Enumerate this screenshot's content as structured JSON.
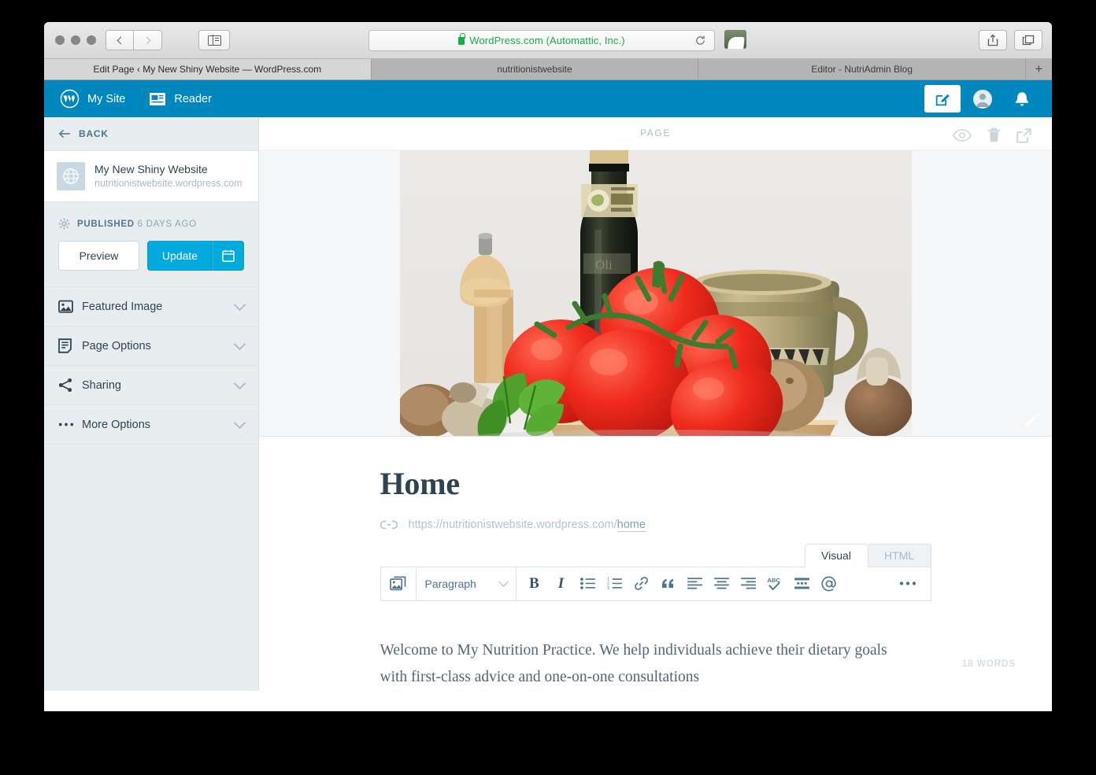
{
  "browser": {
    "url_text": "WordPress.com (Automattic, Inc.)",
    "tabs": [
      {
        "title": "Edit Page ‹ My New Shiny Website — WordPress.com",
        "active": true
      },
      {
        "title": "nutritionistwebsite",
        "active": false
      },
      {
        "title": "Editor - NutriAdmin Blog",
        "active": false
      }
    ],
    "new_tab_label": "+",
    "icons": {
      "back": "back-arrow-icon",
      "forward": "forward-arrow-icon",
      "sidebar": "sidebar-toggle-icon",
      "lock": "lock-icon",
      "reload": "reload-icon",
      "share": "share-icon",
      "tabs_overview": "tab-overview-icon"
    }
  },
  "masthead": {
    "my_site": "My Site",
    "reader": "Reader",
    "accent": "#0087be",
    "icons": {
      "logo": "wordpress-logo-icon",
      "reader": "reader-icon",
      "write": "write-icon",
      "avatar": "avatar-icon",
      "bell": "bell-icon"
    }
  },
  "sidebar": {
    "back_label": "BACK",
    "site": {
      "name": "My New Shiny Website",
      "url": "nutritionistwebsite.wordpress.com"
    },
    "status": {
      "state": "PUBLISHED",
      "time": "6 DAYS AGO"
    },
    "preview_label": "Preview",
    "update_label": "Update",
    "accordion": [
      {
        "label": "Featured Image",
        "icon": "image-icon"
      },
      {
        "label": "Page Options",
        "icon": "document-icon"
      },
      {
        "label": "Sharing",
        "icon": "share-nodes-icon"
      },
      {
        "label": "More Options",
        "icon": "ellipsis-icon"
      }
    ],
    "accent": "#00aadc"
  },
  "main": {
    "page_label": "PAGE",
    "head_icons": [
      {
        "name": "eye-preview-icon"
      },
      {
        "name": "trash-icon"
      },
      {
        "name": "external-link-icon"
      }
    ],
    "featured_image": {
      "alt": "Still life of tomatoes, basil, mushrooms, potatoes, olive oil bottle, pepper grinder and ceramic jug",
      "edit_icon": "pencil-icon"
    },
    "title": "Home",
    "permalink_prefix": "https://nutritionistwebsite.wordpress.com/",
    "permalink_slug": "home",
    "editor_tabs": [
      {
        "label": "Visual",
        "active": true
      },
      {
        "label": "HTML",
        "active": false
      }
    ],
    "toolbar": {
      "paragraph_label": "Paragraph",
      "buttons": [
        {
          "name": "add-media-button",
          "icon": "image-stack-icon"
        },
        {
          "name": "bold-button",
          "icon": "bold-icon",
          "glyph": "B"
        },
        {
          "name": "italic-button",
          "icon": "italic-icon",
          "glyph": "I"
        },
        {
          "name": "bullet-list-button",
          "icon": "bullet-list-icon"
        },
        {
          "name": "numbered-list-button",
          "icon": "numbered-list-icon"
        },
        {
          "name": "link-button",
          "icon": "link-icon"
        },
        {
          "name": "blockquote-button",
          "icon": "quote-icon"
        },
        {
          "name": "align-left-button",
          "icon": "align-left-icon"
        },
        {
          "name": "align-center-button",
          "icon": "align-center-icon"
        },
        {
          "name": "align-right-button",
          "icon": "align-right-icon"
        },
        {
          "name": "spellcheck-button",
          "icon": "spellcheck-abc-icon"
        },
        {
          "name": "insert-read-more-button",
          "icon": "read-more-icon"
        },
        {
          "name": "mention-button",
          "icon": "at-mention-icon"
        },
        {
          "name": "more-tools-button",
          "icon": "ellipsis-icon"
        }
      ]
    },
    "body_text": "Welcome to My Nutrition Practice. We help individuals achieve their dietary goals with first-class advice and one-on-one consultations",
    "word_count": "18 WORDS"
  }
}
